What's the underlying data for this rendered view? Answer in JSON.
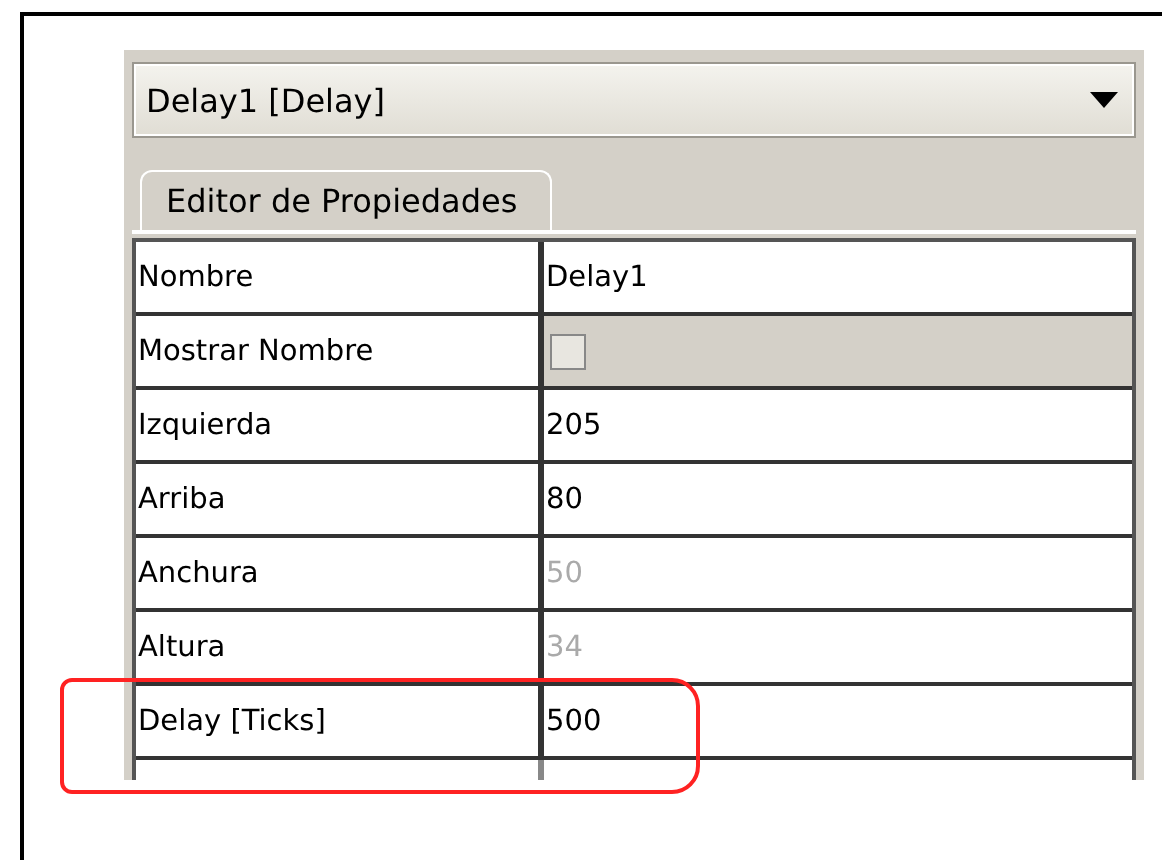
{
  "dropdown": {
    "value": "Delay1 [Delay]"
  },
  "tabs": [
    {
      "label": "Editor de Propiedades",
      "selected": true
    }
  ],
  "properties": [
    {
      "name": "Nombre",
      "kind": "text",
      "value": "Delay1",
      "disabled": false,
      "highlighted": false
    },
    {
      "name": "Mostrar Nombre",
      "kind": "checkbox",
      "checked": false,
      "highlighted": false
    },
    {
      "name": "Izquierda",
      "kind": "text",
      "value": "205",
      "disabled": false,
      "highlighted": false
    },
    {
      "name": "Arriba",
      "kind": "text",
      "value": "80",
      "disabled": false,
      "highlighted": false
    },
    {
      "name": "Anchura",
      "kind": "text",
      "value": "50",
      "disabled": true,
      "highlighted": false
    },
    {
      "name": "Altura",
      "kind": "text",
      "value": "34",
      "disabled": true,
      "highlighted": false
    },
    {
      "name": "Delay [Ticks]",
      "kind": "text",
      "value": "500",
      "disabled": false,
      "highlighted": true
    }
  ]
}
